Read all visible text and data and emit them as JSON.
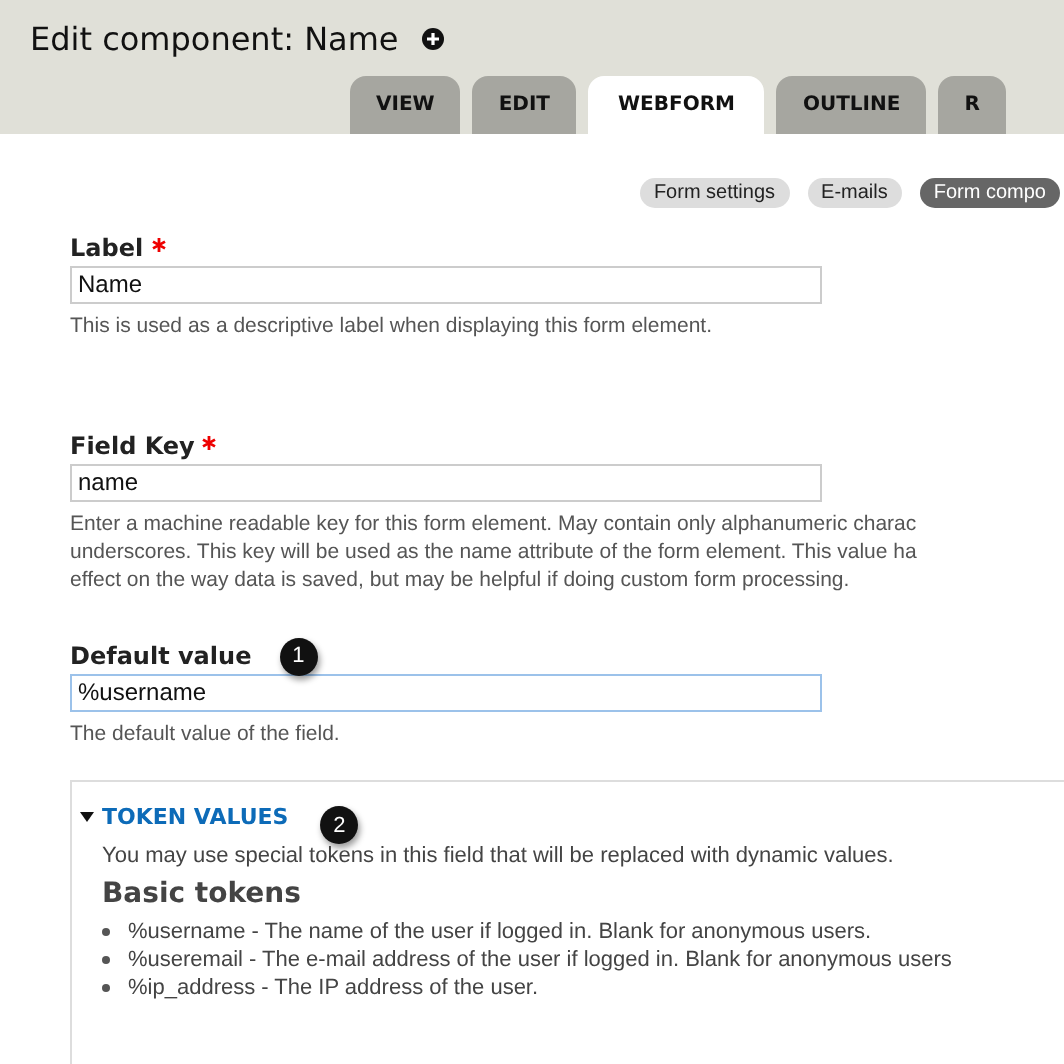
{
  "page_title": "Edit component: Name",
  "tabs": [
    {
      "label": "VIEW",
      "selected": false
    },
    {
      "label": "EDIT",
      "selected": false
    },
    {
      "label": "WEBFORM",
      "selected": true
    },
    {
      "label": "OUTLINE",
      "selected": false
    },
    {
      "label": "R",
      "selected": false
    }
  ],
  "subtabs": [
    {
      "label": "Form settings",
      "selected": false
    },
    {
      "label": "E-mails",
      "selected": false
    },
    {
      "label": "Form compo",
      "selected": true
    }
  ],
  "fields": [
    {
      "label": "Label",
      "required": true,
      "value": "Name",
      "focused": false,
      "description_lines": [
        "This is used as a descriptive label when displaying this form element."
      ]
    },
    {
      "label": "Field Key",
      "required": true,
      "value": "name",
      "focused": false,
      "description_lines": [
        "Enter a machine readable key for this form element. May contain only alphanumeric charac",
        "underscores. This key will be used as the name attribute of the form element. This value ha",
        "effect on the way data is saved, but may be helpful if doing custom form processing."
      ]
    },
    {
      "label": "Default value",
      "required": false,
      "value": "%username",
      "focused": true,
      "callout": "1",
      "description_lines": [
        "The default value of the field."
      ]
    }
  ],
  "token_panel": {
    "title": "TOKEN VALUES",
    "expanded": true,
    "callout": "2",
    "intro": "You may use special tokens in this field that will be replaced with dynamic values.",
    "heading": "Basic tokens",
    "items": [
      "%username - The name of the user if logged in. Blank for anonymous users.",
      "%useremail - The e-mail address of the user if logged in. Blank for anonymous users",
      "%ip_address - The IP address of the user."
    ]
  }
}
